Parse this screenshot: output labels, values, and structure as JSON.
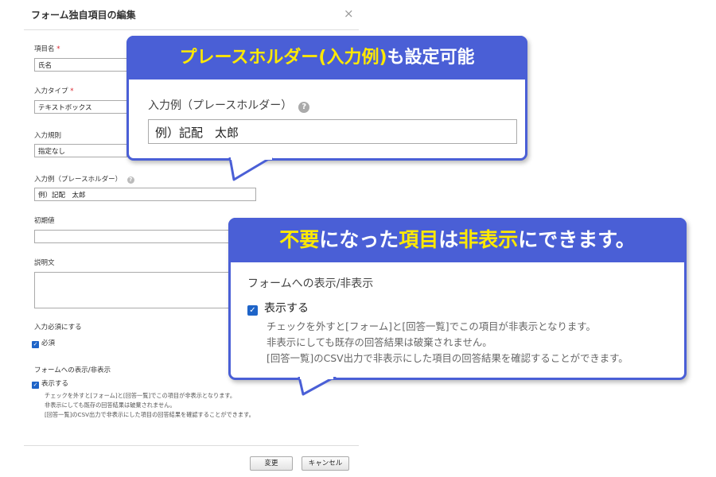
{
  "dialog": {
    "title": "フォーム独自項目の編集",
    "close_glyph": "×",
    "fields": {
      "item_name": {
        "label": "項目名",
        "required_mark": "*",
        "value": "氏名"
      },
      "input_type": {
        "label": "入力タイプ",
        "required_mark": "*",
        "value": "テキストボックス"
      },
      "input_rule": {
        "label": "入力規則",
        "value": "指定なし"
      },
      "placeholder": {
        "label": "入力例（プレースホルダー）",
        "help_glyph": "?",
        "value": "例）記配　太郎"
      },
      "initial_value": {
        "label": "初期値",
        "value": ""
      },
      "description": {
        "label": "説明文",
        "value": ""
      }
    },
    "required": {
      "label": "入力必須にする",
      "checkbox_label": "必須",
      "checked": true
    },
    "visibility": {
      "label": "フォームへの表示/非表示",
      "checkbox_label": "表示する",
      "checked": true,
      "description_lines": [
        "チェックを外すと[フォーム]と[回答一覧]でこの項目が非表示となります。",
        "非表示にしても既存の回答結果は破棄されません。",
        "[回答一覧]のCSV出力で非表示にした項目の回答結果を確認することができます。"
      ]
    },
    "buttons": {
      "change": "変更",
      "cancel": "キャンセル"
    }
  },
  "callout_placeholder": {
    "heading_highlight": "プレースホルダー(入力例)",
    "heading_rest": "も設定可能",
    "label": "入力例（プレースホルダー）",
    "help_glyph": "?",
    "value": "例）記配　太郎"
  },
  "callout_visibility": {
    "heading_parts": [
      "不要",
      "になった",
      "項目",
      "は",
      "非表示",
      "にできます。"
    ],
    "section_label": "フォームへの表示/非表示",
    "checkbox_label": "表示する",
    "description_lines": [
      "チェックを外すと[フォーム]と[回答一覧]でこの項目が非表示となります。",
      "非表示にしても既存の回答結果は破棄されません。",
      "[回答一覧]のCSV出力で非表示にした項目の回答結果を確認することができます。"
    ]
  },
  "colors": {
    "callout_blue": "#4a5fd6",
    "highlight_yellow": "#ffe900",
    "checkbox_blue": "#1e64c8",
    "required_red": "#d9232d"
  }
}
